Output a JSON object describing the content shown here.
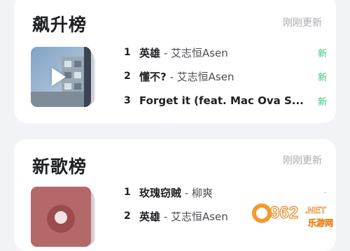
{
  "charts": [
    {
      "title": "飙升榜",
      "status": "刚刚更新",
      "items": [
        {
          "rank": "1",
          "song": "英雄",
          "sep": " - ",
          "artist": "艾志恒Asen",
          "badge": "新"
        },
        {
          "rank": "2",
          "song": "懂不?",
          "sep": "  - ",
          "artist": "艾志恒Asen",
          "badge": "新"
        },
        {
          "rank": "3",
          "song": "Forget it (feat. Mac Ova S...",
          "sep": "",
          "artist": "",
          "badge": "新"
        }
      ]
    },
    {
      "title": "新歌榜",
      "status": "刚刚更新",
      "items": [
        {
          "rank": "1",
          "song": "玫瑰窃贼",
          "sep": " - ",
          "artist": "柳爽",
          "badge": "-"
        },
        {
          "rank": "2",
          "song": "英雄",
          "sep": " - ",
          "artist": "艾志恒Asen",
          "badge": ""
        }
      ]
    }
  ],
  "watermark": {
    "number": "962",
    "suffix": ".NET",
    "subtitle": "乐游网"
  },
  "colors": {
    "accent_new": "#3ec27f",
    "muted": "#a9abb0",
    "text": "#1f2024"
  },
  "icons": [
    "play-icon",
    "album-cover"
  ]
}
